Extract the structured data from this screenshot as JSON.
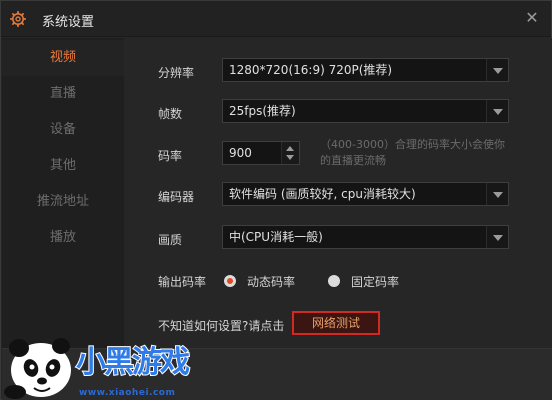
{
  "window": {
    "title": "系统设置",
    "close_label": "✕"
  },
  "sidebar": {
    "items": [
      {
        "label": "视频",
        "active": true
      },
      {
        "label": "直播",
        "active": false
      },
      {
        "label": "设备",
        "active": false
      },
      {
        "label": "其他",
        "active": false
      },
      {
        "label": "推流地址",
        "active": false
      },
      {
        "label": "播放",
        "active": false
      }
    ]
  },
  "video": {
    "resolution_label": "分辨率",
    "resolution_value": "1280*720(16:9) 720P(推荐)",
    "fps_label": "帧数",
    "fps_value": "25fps(推荐)",
    "bitrate_label": "码率",
    "bitrate_value": "900",
    "bitrate_hint": "（400-3000）合理的码率大小会使你的直播更流畅",
    "encoder_label": "编码器",
    "encoder_value": "软件编码 (画质较好, cpu消耗较大)",
    "quality_label": "画质",
    "quality_value": "中(CPU消耗一般)",
    "output_bitrate_label": "输出码率",
    "output_options": [
      {
        "label": "动态码率",
        "checked": true
      },
      {
        "label": "固定码率",
        "checked": false
      }
    ],
    "help_text": "不知道如何设置?请点击",
    "network_test_label": "网络测试"
  },
  "watermark": {
    "brand_text": "小黑游戏",
    "url_text": "www.xiaohei.com"
  },
  "colors": {
    "accent": "#ee7a3a",
    "highlight_border": "#d22a22",
    "background": "#262626"
  }
}
